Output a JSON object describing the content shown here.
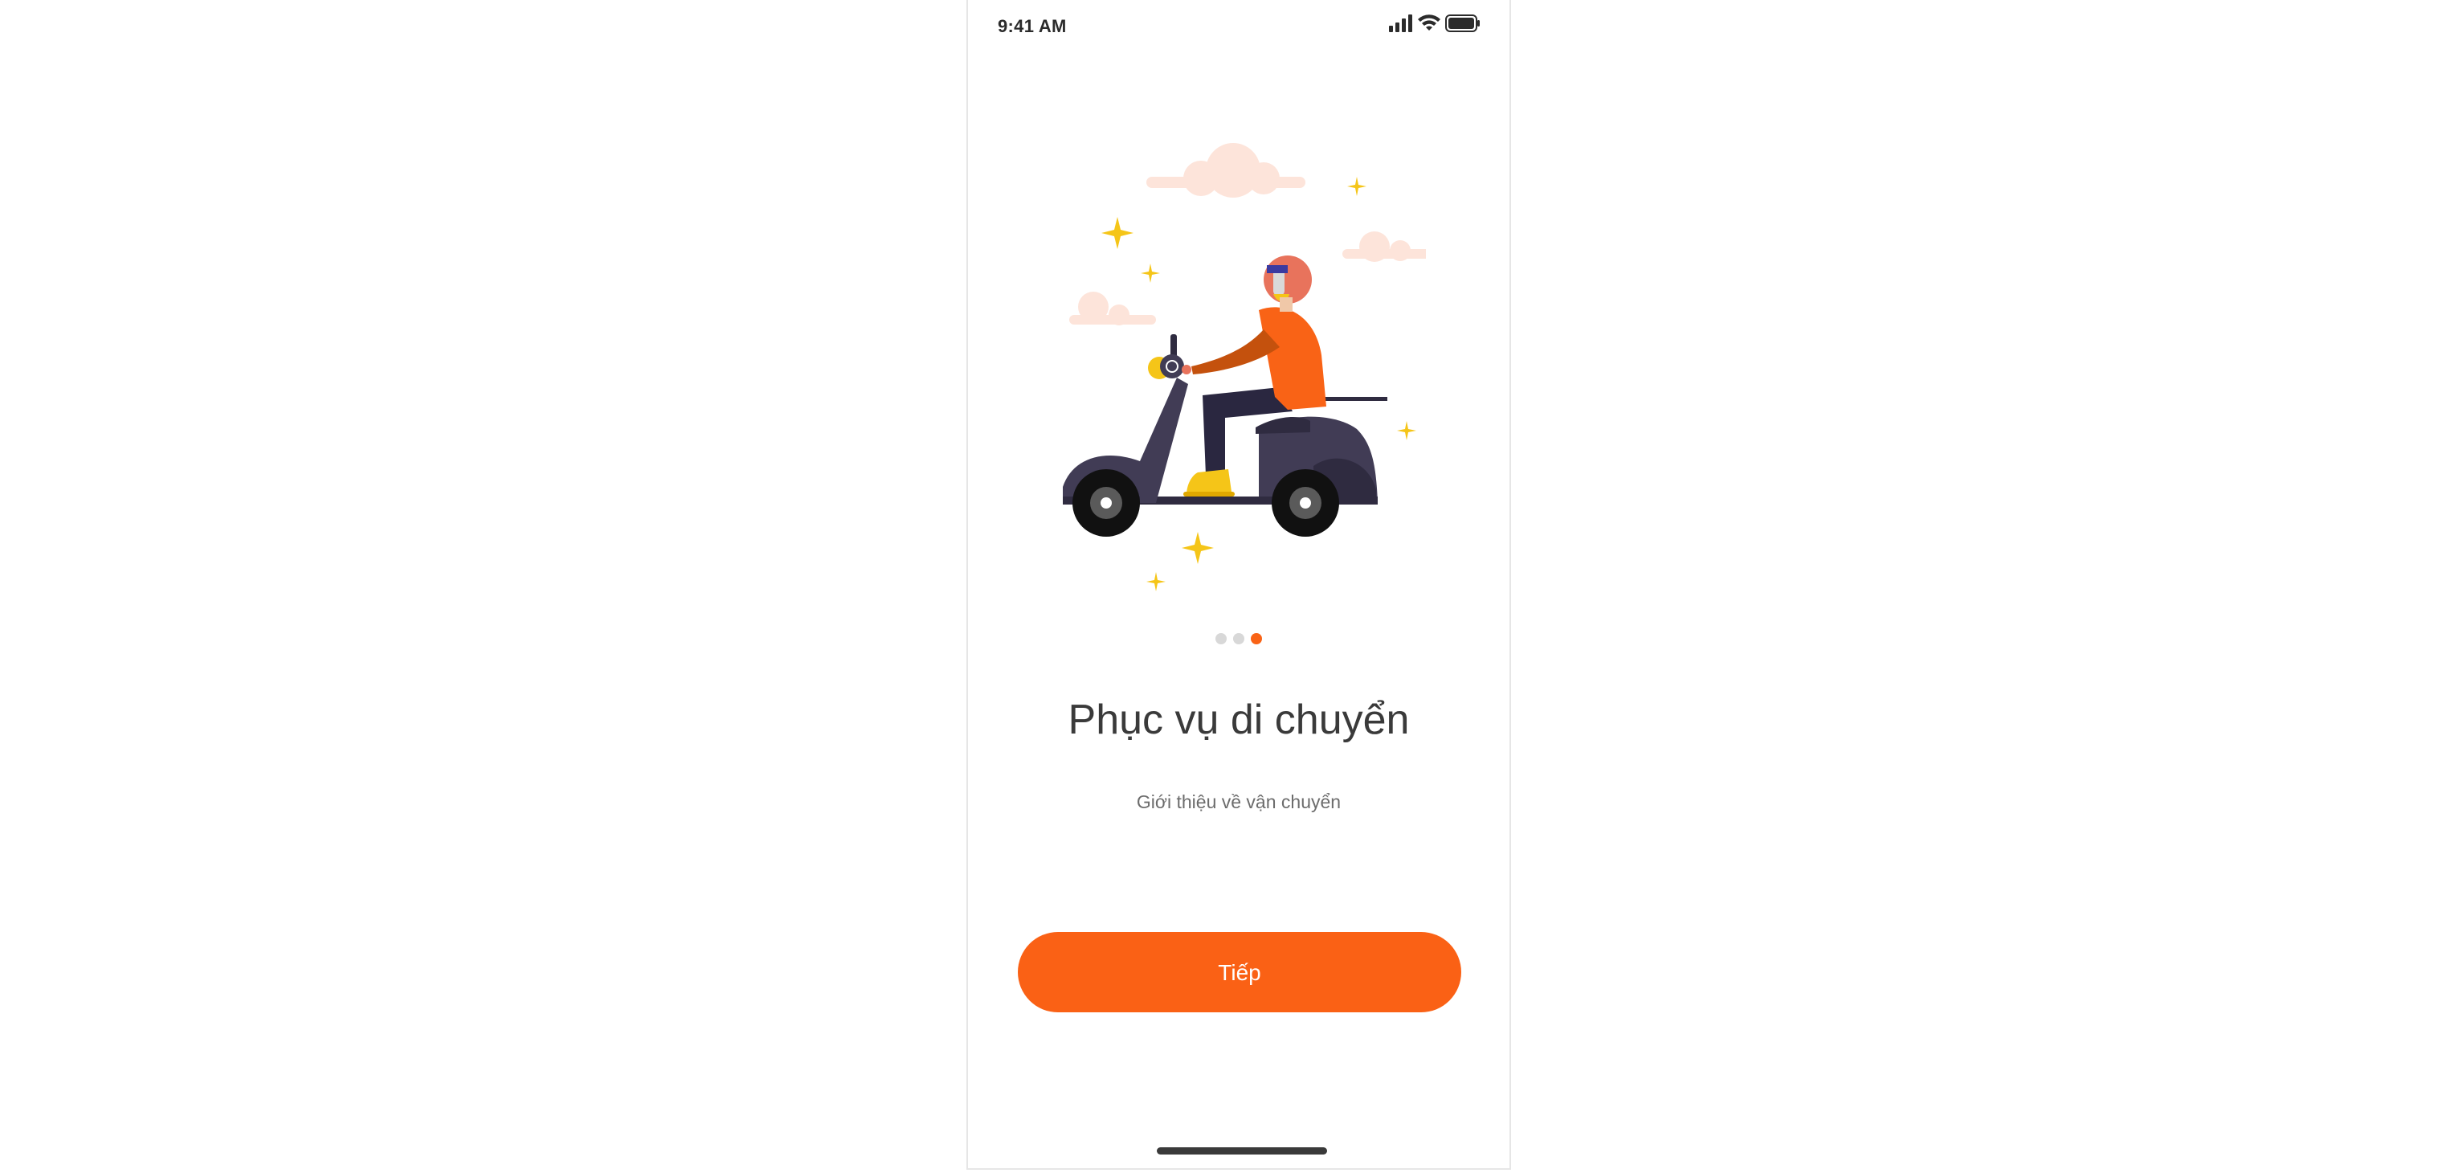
{
  "status_bar": {
    "time": "9:41 AM",
    "icons": [
      "signal-icon",
      "wifi-icon",
      "battery-icon"
    ]
  },
  "onboarding": {
    "illustration": "scooter-rider-illustration",
    "page_indicator": {
      "total": 3,
      "active_index": 2
    },
    "title": "Phục vụ di chuyển",
    "subtitle": "Giới thiệu về vận chuyển",
    "next_button_label": "Tiếp"
  },
  "colors": {
    "accent": "#fa6115",
    "dot_inactive": "#d8d8d8",
    "title_text": "#3a3a3a",
    "subtitle_text": "#6c6c6c"
  }
}
